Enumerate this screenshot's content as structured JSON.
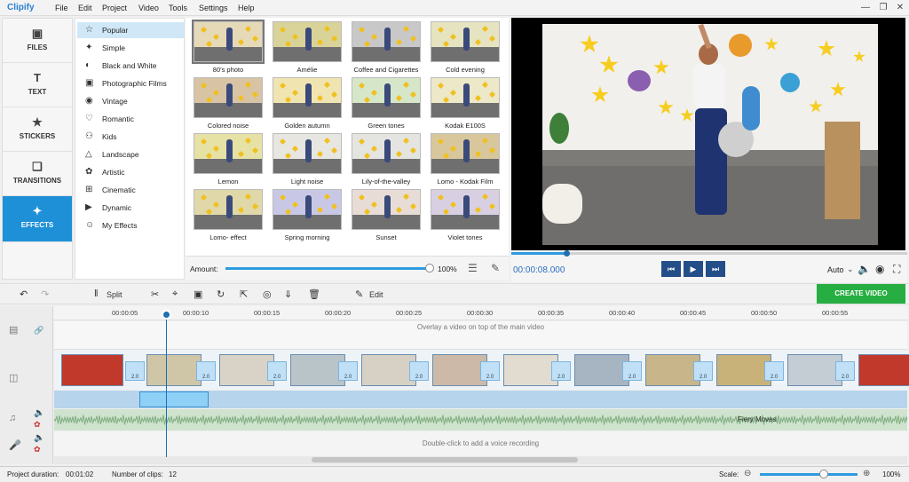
{
  "app": {
    "name": "Clipify",
    "menu": [
      "File",
      "Edit",
      "Project",
      "Video",
      "Tools",
      "Settings",
      "Help"
    ],
    "window_controls": [
      "minimize-icon",
      "restore-icon",
      "close-icon"
    ]
  },
  "nav": {
    "tabs": [
      {
        "label": "FILES",
        "icon": "image-icon"
      },
      {
        "label": "TEXT",
        "icon": "text-icon"
      },
      {
        "label": "STICKERS",
        "icon": "star-icon"
      },
      {
        "label": "TRANSITIONS",
        "icon": "transitions-icon"
      },
      {
        "label": "EFFECTS",
        "icon": "wand-icon",
        "active": true
      }
    ]
  },
  "categories": [
    {
      "label": "Popular",
      "icon": "star-outline-icon",
      "selected": true
    },
    {
      "label": "Simple",
      "icon": "wand-icon"
    },
    {
      "label": "Black and White",
      "icon": "contrast-icon"
    },
    {
      "label": "Photographic Films",
      "icon": "film-icon"
    },
    {
      "label": "Vintage",
      "icon": "camera-icon"
    },
    {
      "label": "Romantic",
      "icon": "heart-icon"
    },
    {
      "label": "Kids",
      "icon": "kids-icon"
    },
    {
      "label": "Landscape",
      "icon": "mountain-icon"
    },
    {
      "label": "Artistic",
      "icon": "palette-icon"
    },
    {
      "label": "Cinematic",
      "icon": "film-reel-icon"
    },
    {
      "label": "Dynamic",
      "icon": "play-circle-icon"
    },
    {
      "label": "My Effects",
      "icon": "user-icon"
    }
  ],
  "effects": [
    {
      "label": "80's photo",
      "tint": "#e6d9b8",
      "selected": true
    },
    {
      "label": "Amélie",
      "tint": "#d9d39a"
    },
    {
      "label": "Coffee and Cigarettes",
      "tint": "#c8c8c8"
    },
    {
      "label": "Cold evening",
      "tint": "#e6e4c0"
    },
    {
      "label": "Colored noise",
      "tint": "#d8c4a4"
    },
    {
      "label": "Golden autumn",
      "tint": "#f0e4b0"
    },
    {
      "label": "Green tones",
      "tint": "#d6e6c8"
    },
    {
      "label": "Kodak E100S",
      "tint": "#ece8c8"
    },
    {
      "label": "Lemon",
      "tint": "#e6e2a6"
    },
    {
      "label": "Light noise",
      "tint": "#e8e6e0"
    },
    {
      "label": "Lily-of-the-valley",
      "tint": "#e4e4e0"
    },
    {
      "label": "Lomo - Kodak Film",
      "tint": "#d8c69c"
    },
    {
      "label": "Lomo- effect",
      "tint": "#e0d8a8"
    },
    {
      "label": "Spring morning",
      "tint": "#c8c8e6"
    },
    {
      "label": "Sunset",
      "tint": "#e8dcd6"
    },
    {
      "label": "Violet tones",
      "tint": "#d8d0e2"
    }
  ],
  "amount": {
    "label": "Amount:",
    "value": "100%",
    "fraction": 1.0
  },
  "player": {
    "time": "00:00:08.000",
    "quality": "Auto",
    "progress": 0.14
  },
  "toolbar": {
    "split": "Split",
    "edit": "Edit",
    "create": "CREATE VIDEO"
  },
  "timeline": {
    "ticks": [
      "00:00:05",
      "00:00:10",
      "00:00:15",
      "00:00:20",
      "00:00:25",
      "00:00:30",
      "00:00:35",
      "00:00:40",
      "00:00:45",
      "00:00:50",
      "00:00:55"
    ],
    "overlay_hint": "Overlay a video on top of the main video",
    "audio_title": "Fiery Moves",
    "voice_hint": "Double-click to add a voice recording",
    "transition_duration": "2.0"
  },
  "status": {
    "duration_label": "Project duration:",
    "duration": "00:01:02",
    "clips_label": "Number of clips:",
    "clips": "12",
    "scale_label": "Scale:",
    "scale": "100%"
  },
  "colors": {
    "accent": "#1e90d8",
    "create": "#27ae43"
  }
}
